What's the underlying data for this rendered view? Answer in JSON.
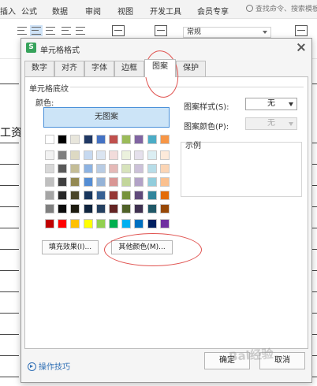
{
  "menubar": {
    "items": [
      "插入",
      "公式",
      "数据",
      "审阅",
      "视图",
      "开发工具",
      "会员专享"
    ],
    "search_placeholder": "查找命令、搜索模板"
  },
  "toolbar": {
    "format_value": "常规"
  },
  "sheet": {
    "cell_text": "工资"
  },
  "dialog": {
    "title": "单元格格式",
    "tabs": [
      "数字",
      "对齐",
      "字体",
      "边框",
      "图案",
      "保护"
    ],
    "active_tab": "图案",
    "section_title": "单元格底纹",
    "color_label": "颜色:",
    "no_pattern_label": "无图案",
    "fill_effects_button": "填充效果(I)...",
    "more_colors_button": "其他颜色(M)...",
    "pattern_style_label": "图案样式(S):",
    "pattern_style_value": "无",
    "pattern_color_label": "图案颜色(P):",
    "pattern_color_value": "无",
    "preview_label": "示例",
    "tips_label": "操作技巧",
    "ok_button": "确定",
    "cancel_button": "取消"
  },
  "palette": {
    "row0": [
      "#ffffff",
      "#000000",
      "#e8e6dc",
      "#1f3864",
      "#4472c4",
      "#c0504d",
      "#9bbb59",
      "#8064a2",
      "#4bacc6",
      "#f79646"
    ],
    "theme_rows": [
      [
        "#f2f2f2",
        "#7f7f7f",
        "#ddd9c3",
        "#c6d9f0",
        "#dbe5f1",
        "#f2dcdb",
        "#ebf1dd",
        "#e5e0ec",
        "#dbeef3",
        "#fdeada"
      ],
      [
        "#d8d8d8",
        "#595959",
        "#c4bd97",
        "#8db3e2",
        "#b8cce4",
        "#e5b9b7",
        "#d7e3bc",
        "#ccc1d9",
        "#b7dde8",
        "#fbd5b5"
      ],
      [
        "#bfbfbf",
        "#3f3f3f",
        "#938953",
        "#548dd4",
        "#95b3d7",
        "#d99694",
        "#c3d69b",
        "#b2a2c7",
        "#92cddc",
        "#fac08f"
      ],
      [
        "#a5a5a5",
        "#262626",
        "#494429",
        "#17365d",
        "#366092",
        "#953734",
        "#76923c",
        "#5f497a",
        "#31859b",
        "#e36c09"
      ],
      [
        "#7f7f7f",
        "#0c0c0c",
        "#1d1b10",
        "#0f243e",
        "#244061",
        "#632423",
        "#4f6128",
        "#3f3151",
        "#205867",
        "#974806"
      ]
    ],
    "standard_row": [
      "#c00000",
      "#ff0000",
      "#ffc000",
      "#ffff00",
      "#92d050",
      "#00b050",
      "#00b0f0",
      "#0070c0",
      "#002060",
      "#7030a0"
    ]
  },
  "accent_colors": {
    "selection": "#cce4f7",
    "link": "#2f6fb5",
    "annotation": "#e0524f"
  }
}
